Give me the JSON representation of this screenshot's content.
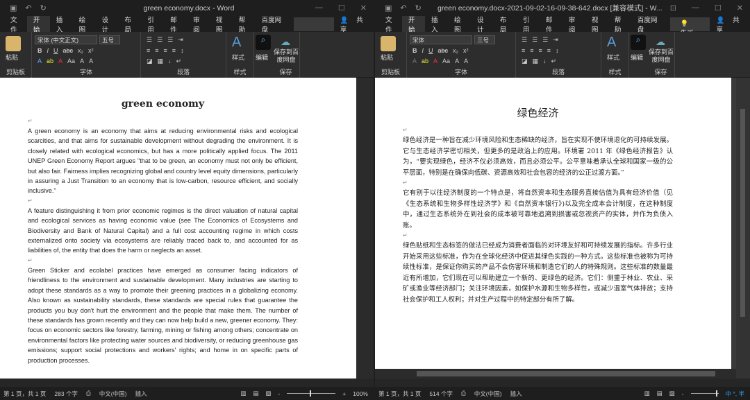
{
  "left": {
    "title": "green economy.docx - Word",
    "tabs": [
      "文件",
      "开始",
      "插入",
      "绘图",
      "设计",
      "布局",
      "引用",
      "邮件",
      "审阅",
      "视图",
      "帮助",
      "百度网盘"
    ],
    "share": "共享",
    "font_name": "宋体 (中文正文)",
    "font_size": "五号",
    "groups": {
      "clipboard": "剪贴板",
      "font": "字体",
      "paragraph": "段落",
      "styles": "样式",
      "editing": "编辑",
      "save": "保存"
    },
    "paste": "粘贴",
    "styles_btn": "样式",
    "edit_btn": "编辑",
    "save_btn": "保存到百度网盘",
    "doc_title": "green economy",
    "paragraphs": [
      "A green economy is an economy that aims at reducing environmental risks and ecological scarcities, and that aims for sustainable development without degrading the environment. It is closely related with ecological economics, but has a more politically applied focus. The 2011 UNEP Green Economy Report argues \"that to be green, an economy must not only be efficient, but also fair. Fairness implies recognizing global and country level equity dimensions, particularly in assuring a Just Transition to an economy that is low-carbon, resource efficient, and socially inclusive.\"",
      "A feature distinguishing it from prior economic regimes is the direct valuation of natural capital and ecological services as having economic value (see The Economics of Ecosystems and Biodiversity and Bank of Natural Capital) and a full cost accounting regime in which costs externalized onto society via ecosystems are reliably traced back to, and accounted for as liabilities of, the entity that does the harm or neglects an asset.",
      "Green Sticker and ecolabel practices have emerged as consumer facing indicators of friendliness to the environment and sustainable development. Many industries are starting to adopt these standards as a way to promote their greening practices in a globalizing economy. Also known as sustainability standards, these standards are special rules that guarantee the products you buy don't hurt the environment and the people that make them. The number of these standards has grown recently and they can now help build a new, greener economy. They: focus on economic sectors like forestry, farming, mining or fishing among others; concentrate on environmental factors like protecting water sources and biodiversity, or reducing greenhouse gas emissions; support social protections and workers' rights; and home in on specific parts of production processes."
    ],
    "status": {
      "page": "第 1 页，共 1 页",
      "words": "283 个字",
      "lang": "中文(中国)",
      "mode": "插入",
      "zoom": "100%"
    }
  },
  "right": {
    "title": "green economy.docx-2021-09-02-16-09-38-642.docx [兼容模式] - W...",
    "tabs": [
      "文件",
      "开始",
      "插入",
      "绘图",
      "设计",
      "布局",
      "引用",
      "邮件",
      "审阅",
      "视图",
      "帮助",
      "百度网盘"
    ],
    "tell_me": "告诉我",
    "share": "共享",
    "font_name": "宋体",
    "font_size": "三号",
    "groups": {
      "clipboard": "剪贴板",
      "font": "字体",
      "paragraph": "段落",
      "styles": "样式",
      "editing": "编辑",
      "save": "保存"
    },
    "paste": "粘贴",
    "styles_btn": "样式",
    "edit_btn": "编辑",
    "save_btn": "保存到百度网盘",
    "doc_title": "绿色经济",
    "paragraphs": [
      "绿色经济是一种旨在减少环境风险和生态稀缺的经济，旨在实现不使环境退化的可持续发展。它与生态经济学密切相关，但更多的是政治上的应用。环境署 2011 年《绿色经济报告》认为，“要实现绿色，经济不仅必须高效，而且必须公平。公平意味着承认全球和国家一级的公平层面，特别是在确保向低碳、资源高效和社会包容的经济的公正过渡方面。”",
      "它有别于以往经济制度的一个特点是，将自然资本和生态服务直接估值为具有经济价值（见《生态系统和生物多样性经济学》和《自然资本银行》)以及完全成本会计制度，在这种制度中，通过生态系统外在到社会的成本被可靠地追溯到损害或忽视资产的实体，并作为负债入账。",
      "绿色贴纸和生态标签的做法已经成为消费者面临的对环境友好和可持续发展的指标。许多行业开始采用这些标准，作为在全球化经济中促进其绿色实践的一种方式。这些标准也被称为可持续性标准，是保证你购买的产品不会伤害环境和制造它们的人的特殊规则。这些标准的数量最近有所增加，它们现在可以帮助建立一个新的、更绿色的经济。它们：侧重于林业、农业、采矿或渔业等经济部门；关注环境因素，如保护水源和生物多样性，或减少温室气体排放；支持社会保护和工人权利；并对生产过程中的特定部分有所了解。"
    ],
    "status": {
      "page": "第 1 页，共 1 页",
      "words": "514 个字",
      "lang": "中文(中国)",
      "mode": "插入"
    },
    "ime": "中 °, 半"
  }
}
